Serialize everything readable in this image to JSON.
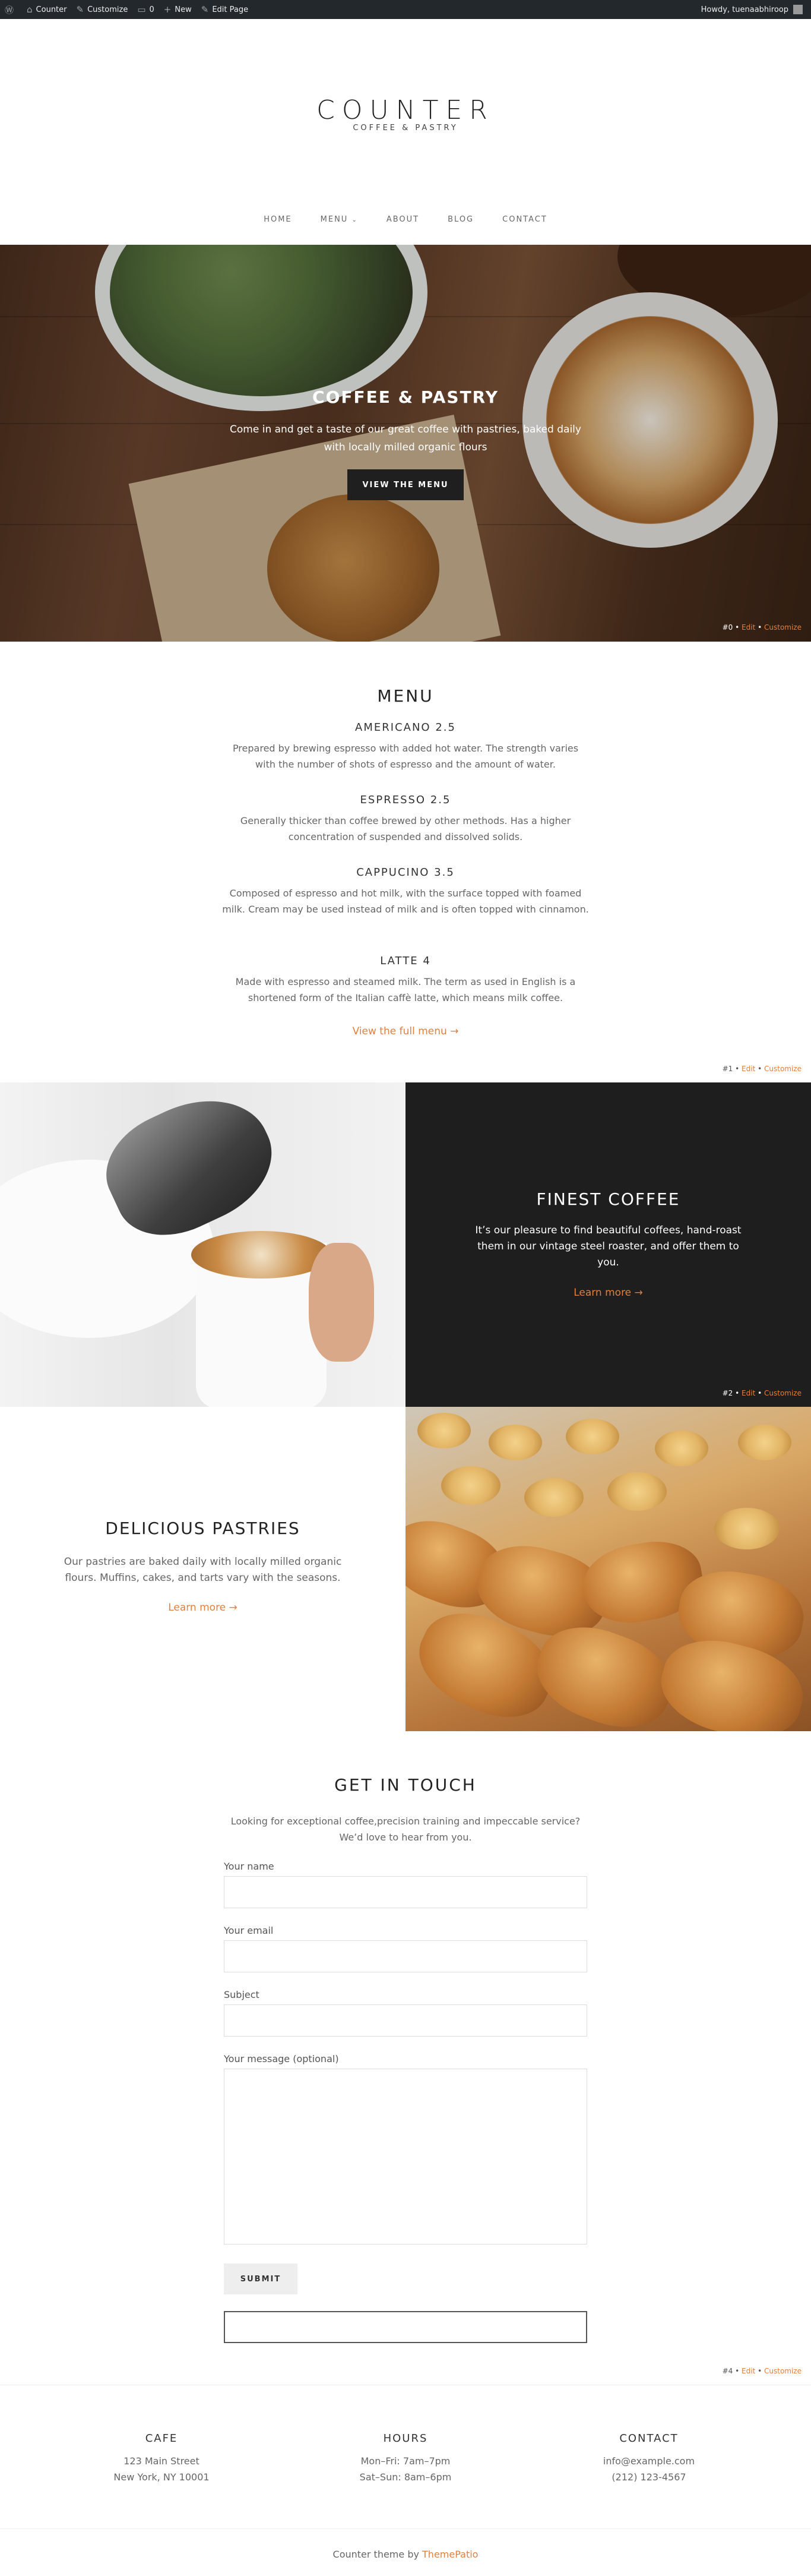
{
  "admin_bar": {
    "site_name": "Counter",
    "customize": "Customize",
    "comments_count": "0",
    "new": "New",
    "edit_page": "Edit Page",
    "howdy": "Howdy, tuenaabhiroop"
  },
  "header": {
    "title": "COUNTER",
    "tagline": "COFFEE & PASTRY"
  },
  "nav": {
    "home": "HOME",
    "menu": "MENU",
    "about": "ABOUT",
    "blog": "BLOG",
    "contact": "CONTACT"
  },
  "hero": {
    "title": "COFFEE & PASTRY",
    "text": "Come in and get a taste of our great coffee with pastries, baked daily with locally milled organic flours",
    "button": "VIEW THE MENU",
    "edit_num": "#0",
    "edit": "Edit",
    "customize": "Customize"
  },
  "menu": {
    "title": "MENU",
    "items": [
      {
        "name": "AMERICANO 2.5",
        "desc": "Prepared by brewing espresso with added hot water. The strength varies with the number of shots of espresso and the amount of water."
      },
      {
        "name": "ESPRESSO 2.5",
        "desc": "Generally thicker than coffee brewed by other methods. Has a higher concentration of suspended and dissolved solids."
      },
      {
        "name": "CAPPUCINO 3.5",
        "desc": "Composed of espresso and hot milk, with the surface topped with foamed milk. Cream may be used instead of milk and is often topped with cinnamon."
      },
      {
        "name": "LATTE 4",
        "desc": "Made with espresso and steamed milk. The term as used in English is a shortened form of the Italian caffè latte, which means milk coffee."
      }
    ],
    "link": "View the full menu →",
    "edit_num": "#1",
    "edit": "Edit",
    "customize": "Customize"
  },
  "finest": {
    "title": "FINEST COFFEE",
    "text": "It’s our pleasure to find beautiful coffees, hand-roast them in our vintage steel roaster, and offer them to you.",
    "link": "Learn more →",
    "edit_num": "#2",
    "edit": "Edit",
    "customize": "Customize"
  },
  "pastries": {
    "title": "DELICIOUS PASTRIES",
    "text": "Our pastries are baked daily with locally milled organic flours. Muffins, cakes, and tarts vary with the seasons.",
    "link": "Learn more →"
  },
  "contact_form": {
    "title": "GET IN TOUCH",
    "intro": "Looking for exceptional coffee,precision training and impeccable service? We’d love to hear from you.",
    "name_label": "Your name",
    "email_label": "Your email",
    "subject_label": "Subject",
    "message_label": "Your message (optional)",
    "submit": "SUBMIT",
    "edit_num": "#4",
    "edit": "Edit",
    "customize": "Customize"
  },
  "footer": {
    "cafe": {
      "heading": "CAFE",
      "line1": "123 Main Street",
      "line2": "New York, NY 10001"
    },
    "hours": {
      "heading": "HOURS",
      "line1": "Mon–Fri: 7am–7pm",
      "line2": "Sat–Sun: 8am–6pm"
    },
    "contact": {
      "heading": "CONTACT",
      "line1": "info@example.com",
      "line2": "(212) 123-4567"
    },
    "credit_prefix": "Counter theme by",
    "credit_link": "ThemePatio"
  },
  "colors": {
    "accent": "#e08040",
    "admin_bar": "#23282d",
    "dark_panel": "#1e1e1e"
  }
}
